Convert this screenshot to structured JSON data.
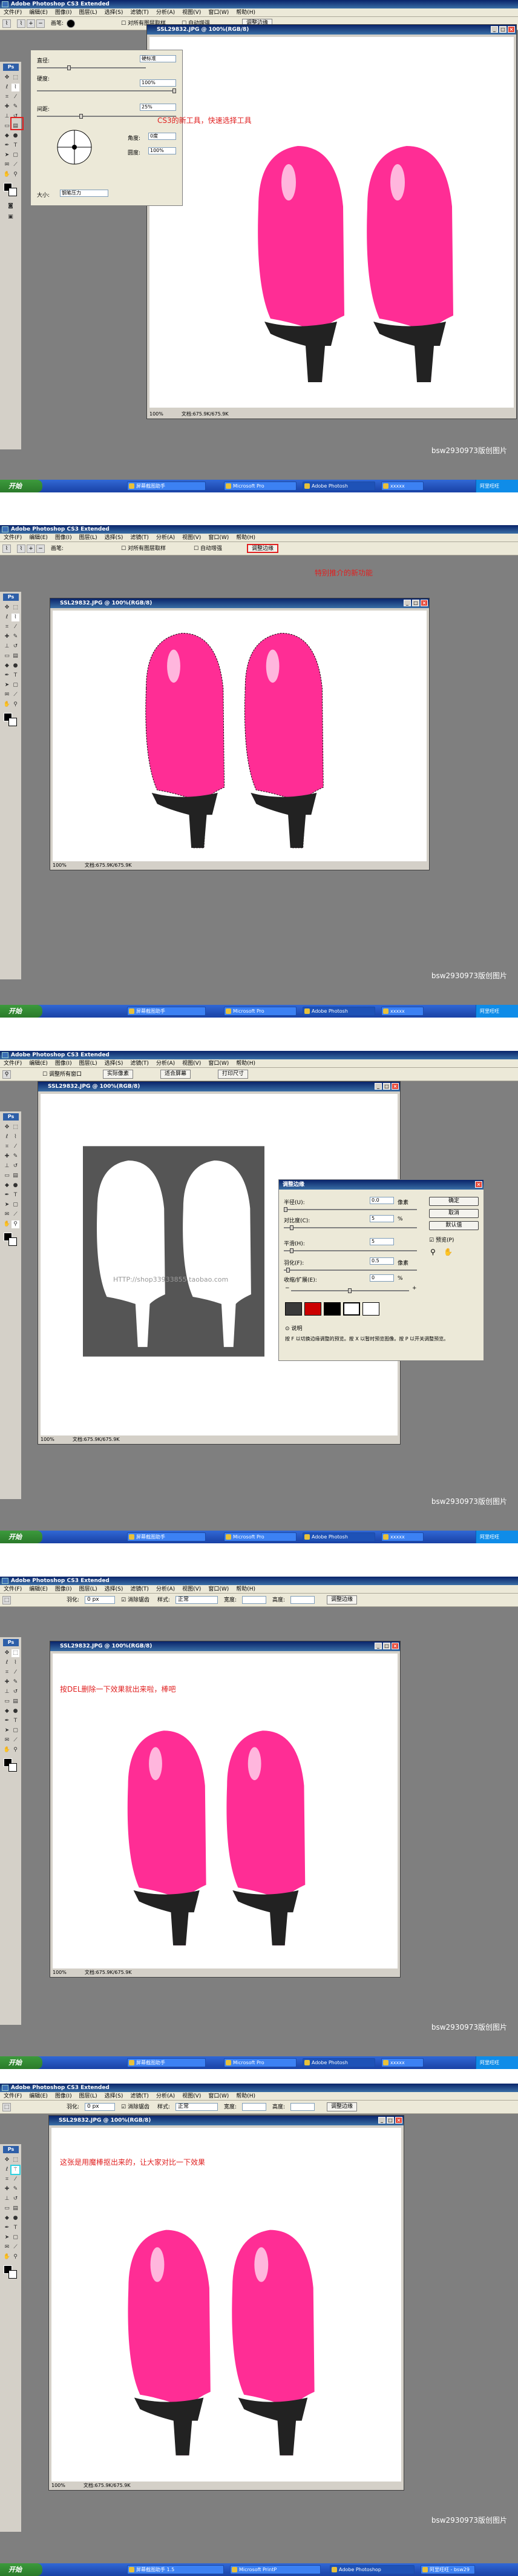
{
  "app": {
    "title": "Adobe Photoshop CS3 Extended",
    "menus": [
      "文件(F)",
      "编辑(E)",
      "图像(I)",
      "图层(L)",
      "选择(S)",
      "滤镜(T)",
      "分析(A)",
      "视图(V)",
      "窗口(W)",
      "帮助(H)"
    ],
    "toolbox_label": "Ps",
    "watermark": "bsw2930973版创图片"
  },
  "document": {
    "title": "SSL29832.JPG @ 100%(RGB/8)",
    "zoom": "100%",
    "doc_size": "文档:675.9K/675.9K"
  },
  "colors": {
    "accent_red": "#e02020",
    "titlebar": "#0a246a",
    "shoe_pink": "#ff2d95"
  },
  "taskbar": {
    "start": "开始",
    "items": [
      "屏幕截图助手",
      "Microsoft Pro",
      "Adobe Photosh",
      "xxxxx",
      "阿里旺旺"
    ],
    "items_s5": [
      "屏幕截图助手 1.5",
      "Microsoft PrintP",
      "Adobe Photoshop",
      "阿里旺旺 - bsw29"
    ]
  },
  "shot1": {
    "options": {
      "sample_all": "对所有图层取样",
      "auto_enhance": "自动增强",
      "refine_edge": "调整边缘"
    },
    "brush_popup": {
      "diameter_label": "直径:",
      "diameter_value": "硬标准",
      "hardness_label": "硬度:",
      "hardness_value": "100%",
      "spacing_label": "间距:",
      "spacing_value": "25%",
      "angle_label": "角度:",
      "angle_value": "0度",
      "roundness_label": "圆度:",
      "roundness_value": "100%",
      "size_label": "大小:",
      "size_value": "钢笔压力"
    },
    "note": "CS3的新工具，快速选择工具"
  },
  "shot2": {
    "options": {
      "sample_all": "对所有图层取样",
      "auto_enhance": "自动增强",
      "refine_edge": "调整边缘"
    },
    "note": "特别推介的新功能"
  },
  "shot3": {
    "options": {
      "resize": "调整所有窗口",
      "actual": "实际像素",
      "fit": "适合屏幕",
      "print": "打印尺寸"
    },
    "dialog": {
      "title": "调整边缘",
      "ok": "确定",
      "cancel": "取消",
      "default": "默认值",
      "radius_label": "半径(U):",
      "radius_value": "0.0",
      "radius_unit": "像素",
      "contrast_label": "对比度(C):",
      "contrast_value": "5",
      "contrast_unit": "%",
      "smooth_label": "平滑(H):",
      "smooth_value": "5",
      "feather_label": "羽化(F):",
      "feather_value": "0.5",
      "feather_unit": "像素",
      "contract_label": "收缩/扩展(E):",
      "contract_value": "0",
      "contract_unit": "%",
      "minus": "−",
      "plus": "+",
      "preview_label": "预览(P)",
      "desc_label": "说明",
      "desc_text": "按 F 以切换边缘调整的预览。按 X 以暂时预览图像。按 P 以开关调整预览。"
    },
    "watermark_overlay": "HTTP://shop33933855.taobao.com"
  },
  "shot4": {
    "options": {
      "feather_label": "羽化:",
      "feather_value": "0 px",
      "antialias": "消除锯齿",
      "style_label": "样式:",
      "style_value": "正常",
      "width_label": "宽度:",
      "height_label": "高度:",
      "refine_edge": "调整边缘"
    },
    "note": "按DEL删除一下效果就出来啦，棒吧"
  },
  "shot5": {
    "options": {
      "feather_label": "羽化:",
      "feather_value": "0 px",
      "antialias": "消除锯齿",
      "style_label": "样式:",
      "style_value": "正常",
      "width_label": "宽度:",
      "height_label": "高度:",
      "refine_edge": "调整边缘"
    },
    "note": "这张是用魔棒抠出来的，让大家对比一下效果"
  }
}
